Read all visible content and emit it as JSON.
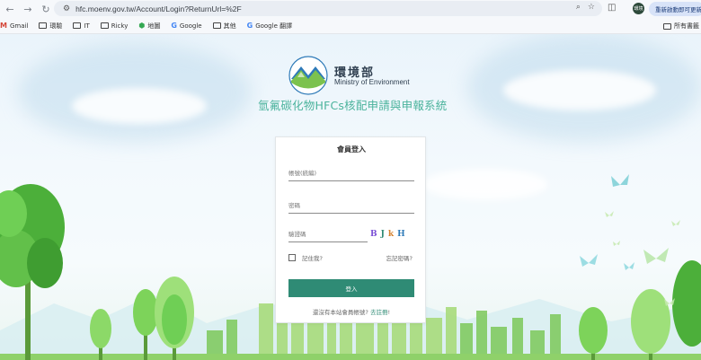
{
  "browser": {
    "url": "hfc.moenv.gov.tw/Account/Login?ReturnUrl=%2F",
    "update_button": "重新啟動即可更新",
    "profile_initials": "環境"
  },
  "bookmarks": {
    "items": [
      {
        "label": "Gmail",
        "icon": "gmail-icon"
      },
      {
        "label": "環驗",
        "icon": "folder-icon"
      },
      {
        "label": "IT",
        "icon": "folder-icon"
      },
      {
        "label": "Ricky",
        "icon": "folder-icon"
      },
      {
        "label": "地圖",
        "icon": "maps-icon"
      },
      {
        "label": "Google",
        "icon": "google-icon"
      },
      {
        "label": "其他",
        "icon": "folder-icon"
      },
      {
        "label": "Google 翻譯",
        "icon": "google-icon"
      }
    ],
    "all_bookmarks": "所有書籤"
  },
  "header": {
    "org_name_cn": "環境部",
    "org_name_en": "Ministry of Environment",
    "system_title": "氫氟碳化物HFCs核配申請與申報系統"
  },
  "login": {
    "title": "會員登入",
    "account_placeholder": "帳號(統編)",
    "password_placeholder": "密碼",
    "captcha_placeholder": "驗證碼",
    "captcha_chars": [
      "B",
      "J",
      "k",
      "H"
    ],
    "remember_label": "記住我?",
    "forgot_label": "忘記密碼?",
    "login_button": "登入",
    "register_prompt": "還沒有本站會員帳號?",
    "register_link": "去註冊"
  },
  "colors": {
    "accent": "#2f8b75",
    "title_green": "#4bb39c",
    "tree_green": "#6cc04a"
  }
}
